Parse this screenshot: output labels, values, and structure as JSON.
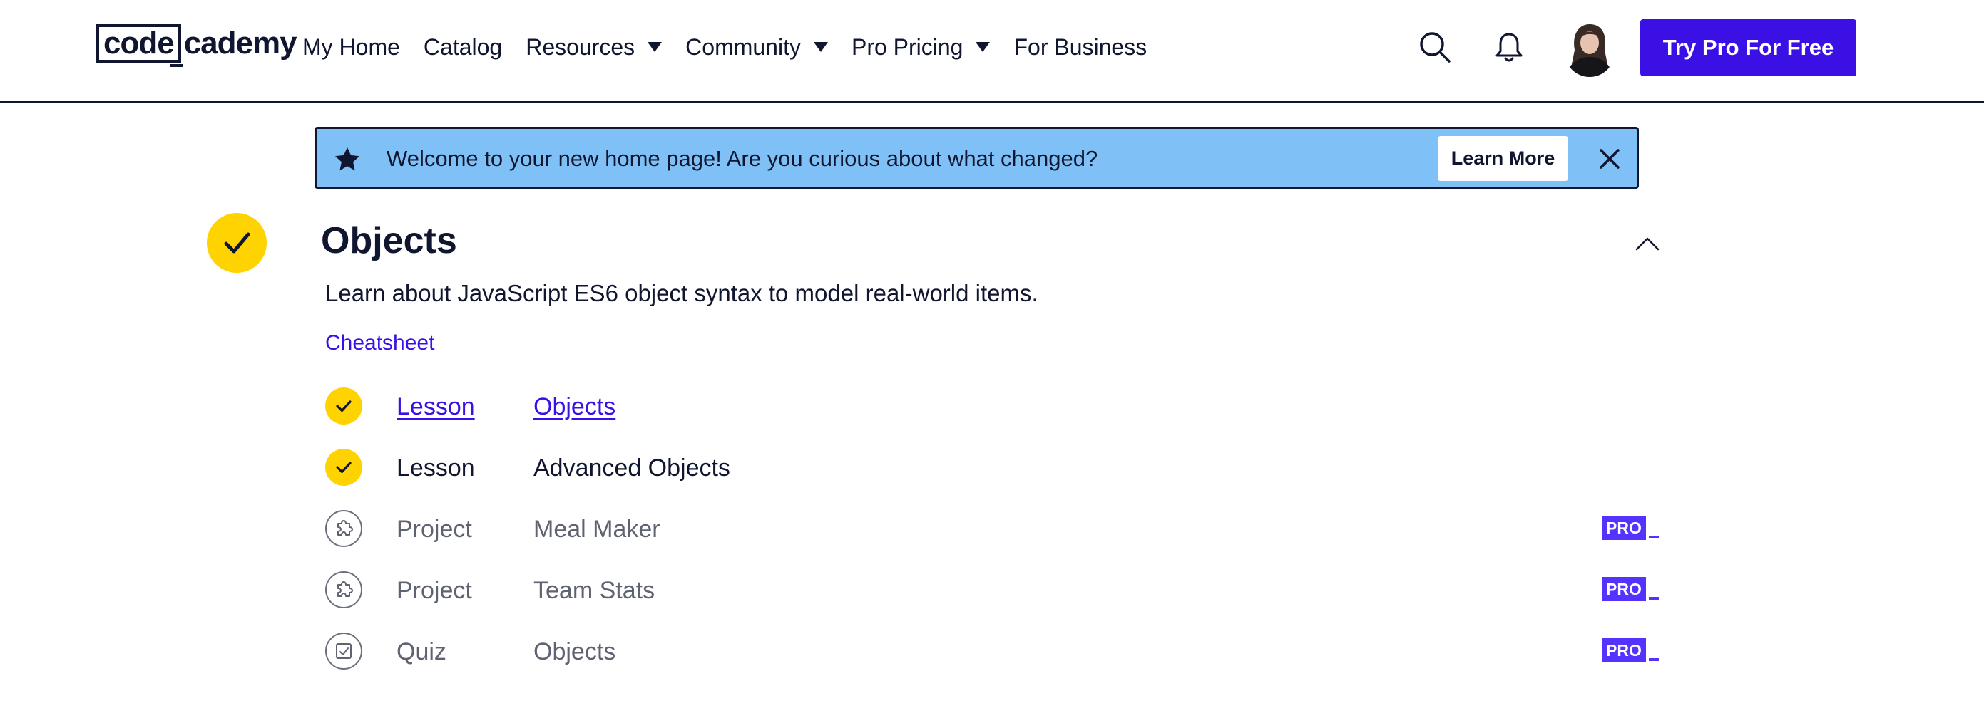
{
  "logo": {
    "part1": "code",
    "part2": "cademy"
  },
  "nav": {
    "items": [
      {
        "label": "My Home",
        "dropdown": false
      },
      {
        "label": "Catalog",
        "dropdown": false
      },
      {
        "label": "Resources",
        "dropdown": true
      },
      {
        "label": "Community",
        "dropdown": true
      },
      {
        "label": "Pro Pricing",
        "dropdown": true
      },
      {
        "label": "For Business",
        "dropdown": false
      }
    ]
  },
  "header": {
    "cta_label": "Try Pro For Free"
  },
  "banner": {
    "message": "Welcome to your new home page! Are you curious about what changed?",
    "button_label": "Learn More",
    "background": "#7fc1f6"
  },
  "module": {
    "title": "Objects",
    "description": "Learn about JavaScript ES6 object syntax to model real-world items.",
    "cheatsheet_label": "Cheatsheet",
    "items": [
      {
        "type": "Lesson",
        "name": "Objects",
        "completed": true,
        "linked": true,
        "pro": false
      },
      {
        "type": "Lesson",
        "name": "Advanced Objects",
        "completed": true,
        "linked": false,
        "pro": false
      },
      {
        "type": "Project",
        "name": "Meal Maker",
        "completed": false,
        "linked": false,
        "pro": true,
        "badge": "PRO"
      },
      {
        "type": "Project",
        "name": "Team Stats",
        "completed": false,
        "linked": false,
        "pro": true,
        "badge": "PRO"
      },
      {
        "type": "Quiz",
        "name": "Objects",
        "completed": false,
        "linked": false,
        "pro": true,
        "badge": "PRO"
      }
    ]
  },
  "colors": {
    "brand": "#3a10e5",
    "complete": "#ffd300",
    "navy": "#10162f",
    "pro": "#5533ff"
  }
}
